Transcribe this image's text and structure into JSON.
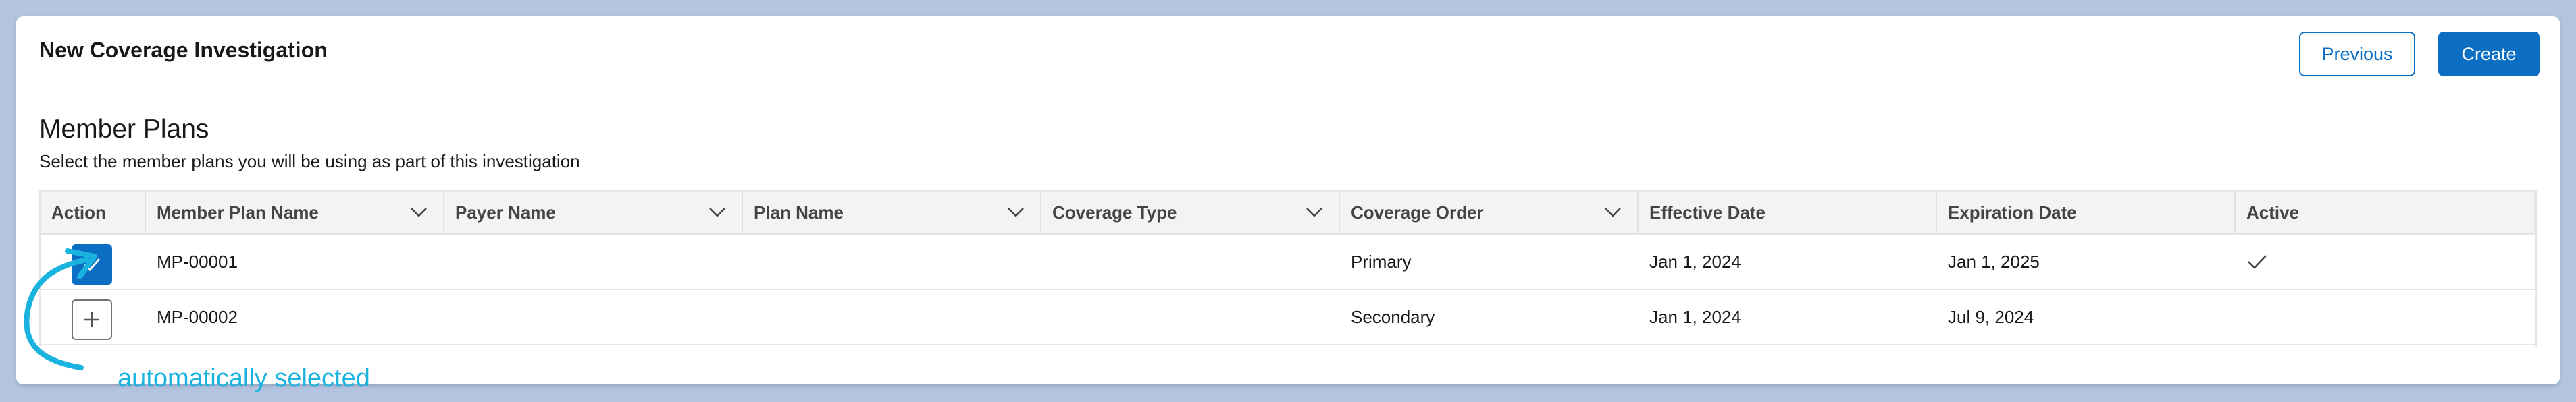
{
  "page": {
    "title": "New Coverage Investigation",
    "buttons": {
      "previous": "Previous",
      "create": "Create"
    }
  },
  "section": {
    "title": "Member Plans",
    "subtitle": "Select the member plans you will be using as part of this investigation"
  },
  "table": {
    "columns": [
      {
        "label": "Action",
        "sortable": false
      },
      {
        "label": "Member Plan Name",
        "sortable": true
      },
      {
        "label": "Payer Name",
        "sortable": true
      },
      {
        "label": "Plan Name",
        "sortable": true
      },
      {
        "label": "Coverage Type",
        "sortable": true
      },
      {
        "label": "Coverage Order",
        "sortable": true
      },
      {
        "label": "Effective Date",
        "sortable": false
      },
      {
        "label": "Expiration Date",
        "sortable": false
      },
      {
        "label": "Active",
        "sortable": false
      }
    ],
    "rows": [
      {
        "selected": true,
        "member_plan_name": "MP-00001",
        "payer_name": "",
        "plan_name": "",
        "coverage_type": "",
        "coverage_order": "Primary",
        "effective_date": "Jan 1, 2024",
        "expiration_date": "Jan 1, 2025",
        "active": true
      },
      {
        "selected": false,
        "member_plan_name": "MP-00002",
        "payer_name": "",
        "plan_name": "",
        "coverage_type": "",
        "coverage_order": "Secondary",
        "effective_date": "Jan 1, 2024",
        "expiration_date": "Jul 9, 2024",
        "active": false
      }
    ]
  },
  "annotation": {
    "text": "automatically selected",
    "color": "#1ab3e0"
  },
  "colors": {
    "brand": "#0b6ec2",
    "background": "#b3c4e0",
    "header_bg": "#f3f3f3"
  },
  "icons": {
    "sort": "chevron-down-icon",
    "selected": "check-icon",
    "unselected": "plus-icon",
    "active": "check-icon"
  }
}
